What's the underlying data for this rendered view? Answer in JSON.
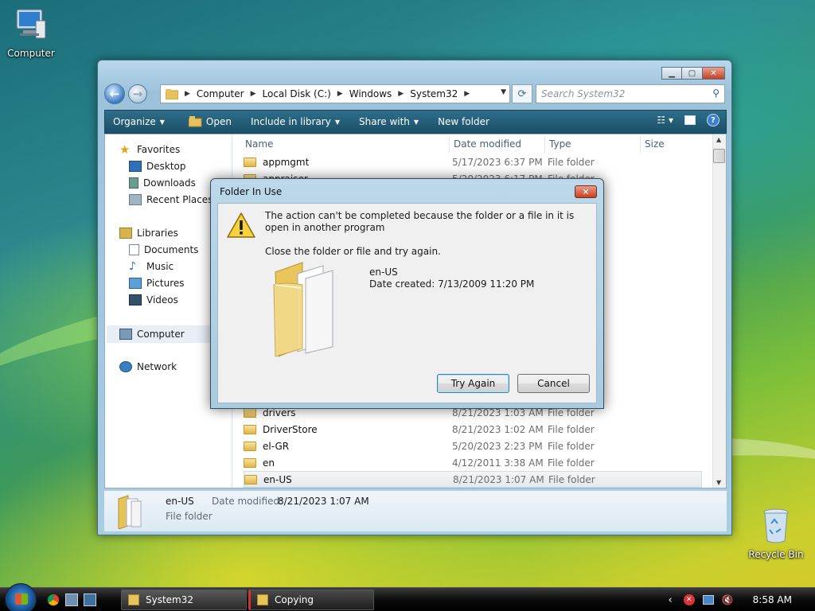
{
  "desktop": {
    "icons": [
      {
        "label": "Computer"
      },
      {
        "label": "Recycle Bin"
      }
    ]
  },
  "window": {
    "address": {
      "crumbs": [
        "Computer",
        "Local Disk (C:)",
        "Windows",
        "System32"
      ]
    },
    "search": {
      "placeholder": "Search System32"
    },
    "toolbar": {
      "organize": "Organize",
      "open": "Open",
      "include": "Include in library",
      "share": "Share with",
      "new_folder": "New folder"
    },
    "nav": {
      "favorites": "Favorites",
      "desktop": "Desktop",
      "downloads": "Downloads",
      "recent": "Recent Places",
      "libraries": "Libraries",
      "documents": "Documents",
      "music": "Music",
      "pictures": "Pictures",
      "videos": "Videos",
      "computer": "Computer",
      "network": "Network"
    },
    "columns": {
      "name": "Name",
      "date": "Date modified",
      "type": "Type",
      "size": "Size"
    },
    "files": [
      {
        "name": "appmgmt",
        "date": "5/17/2023 6:37 PM",
        "type": "File folder"
      },
      {
        "name": "appraiser",
        "date": "5/20/2023 6:17 PM",
        "type": "File folder"
      },
      {
        "name": "drivers",
        "date": "8/21/2023 1:03 AM",
        "type": "File folder"
      },
      {
        "name": "DriverStore",
        "date": "8/21/2023 1:02 AM",
        "type": "File folder"
      },
      {
        "name": "el-GR",
        "date": "5/20/2023 2:23 PM",
        "type": "File folder"
      },
      {
        "name": "en",
        "date": "4/12/2011 3:38 AM",
        "type": "File folder"
      },
      {
        "name": "en-US",
        "date": "8/21/2023 1:07 AM",
        "type": "File folder"
      }
    ],
    "details": {
      "name": "en-US",
      "type": "File folder",
      "date_label": "Date modified:",
      "date_value": "8/21/2023 1:07 AM"
    }
  },
  "dialog": {
    "title": "Folder In Use",
    "message": "The action can't be completed because the folder or a file in it is open in another program",
    "instruction": "Close the folder or file and try again.",
    "folder_name": "en-US",
    "folder_date": "Date created: 7/13/2009 11:20 PM",
    "try_again": "Try Again",
    "cancel": "Cancel"
  },
  "taskbar": {
    "tasks": [
      {
        "label": "System32"
      },
      {
        "label": "Copying"
      }
    ],
    "clock": "8:58 AM"
  }
}
